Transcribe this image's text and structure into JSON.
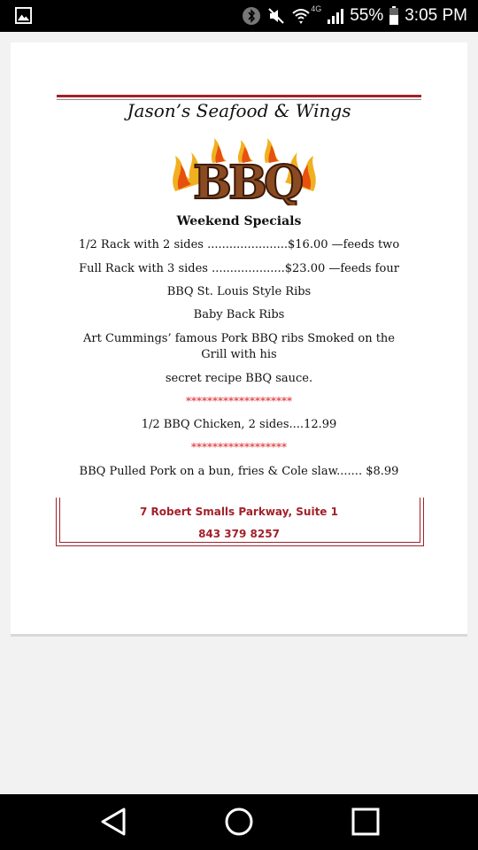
{
  "status_bar": {
    "network_label": "4G",
    "battery_percent": "55%",
    "time": "3:05 PM",
    "icons": [
      "gallery-icon",
      "bluetooth-icon",
      "mute-icon",
      "wifi-icon",
      "signal-icon",
      "battery-icon"
    ]
  },
  "menu": {
    "title": "Jason’s Seafood & Wings",
    "logo_text": "BBQ",
    "heading": "Weekend Specials",
    "lines": [
      "1/2 Rack with 2 sides ......................$16.00 —feeds two",
      "Full Rack with 3 sides ....................$23.00 —feeds four",
      "BBQ St. Louis Style Ribs",
      "Baby Back Ribs",
      "Art Cummings’ famous Pork BBQ ribs Smoked on the",
      "Grill with his",
      "secret recipe BBQ sauce.",
      "********************",
      "1/2 BBQ Chicken, 2 sides....12.99",
      "******************",
      "BBQ Pulled Pork on a bun, fries & Cole slaw....... $8.99"
    ],
    "address": "7 Robert Smalls Parkway, Suite 1",
    "phone": "843 379 8257"
  },
  "nav_bar": {
    "buttons": [
      "back-button",
      "home-button",
      "recents-button"
    ]
  },
  "colors": {
    "accent_red": "#a3202a",
    "stars_red": "#dd2222"
  }
}
